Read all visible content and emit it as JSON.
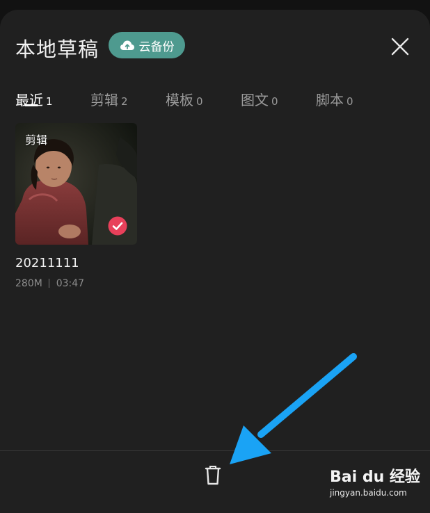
{
  "header": {
    "title": "本地草稿",
    "backup_label": "云备份"
  },
  "tabs": [
    {
      "label": "最近",
      "count": "1",
      "active": true
    },
    {
      "label": "剪辑",
      "count": "2",
      "active": false
    },
    {
      "label": "模板",
      "count": "0",
      "active": false
    },
    {
      "label": "图文",
      "count": "0",
      "active": false
    },
    {
      "label": "脚本",
      "count": "0",
      "active": false
    }
  ],
  "drafts": [
    {
      "type_label": "剪辑",
      "name": "20211111",
      "size": "280M",
      "duration": "03:47",
      "selected": true
    }
  ],
  "footer": {
    "delete_icon": "trash-icon"
  },
  "watermark": {
    "logo": "Bai du 经验",
    "url": "jingyan.baidu.com"
  },
  "colors": {
    "sheet_bg": "#202020",
    "accent": "#4e9a8f",
    "check": "#e8405a",
    "arrow": "#1aa3f5"
  }
}
